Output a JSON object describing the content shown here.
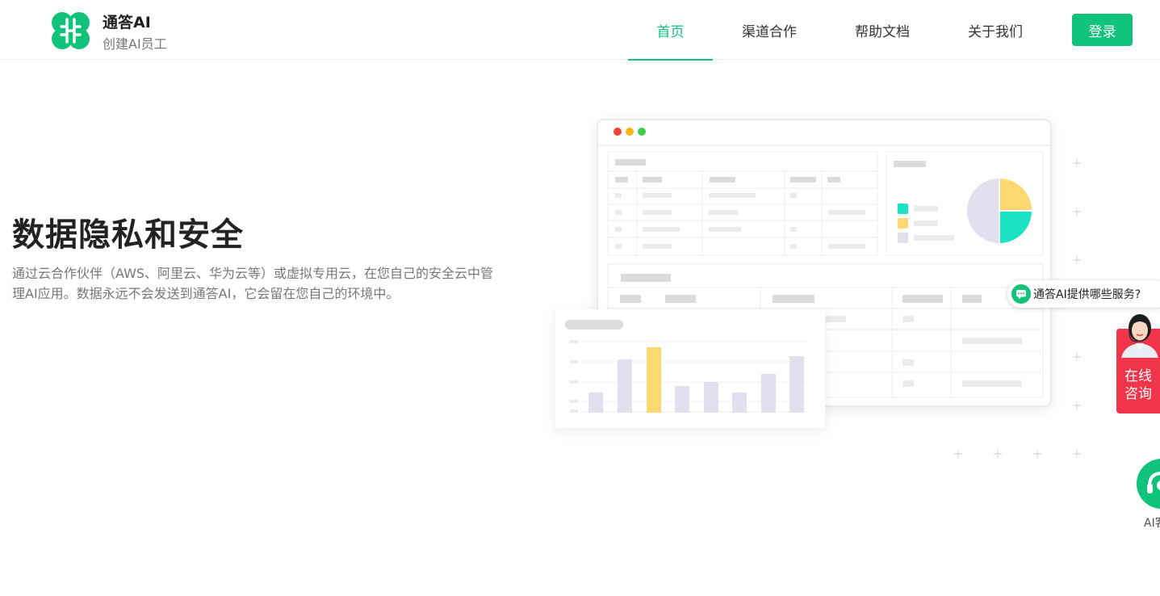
{
  "brand": {
    "title": "通答AI",
    "subtitle": "创建AI员工",
    "logo_icon": "brain-leaf-icon",
    "accent_color": "#10c27a"
  },
  "nav": {
    "items": [
      {
        "label": "首页",
        "active": true
      },
      {
        "label": "渠道合作",
        "active": false
      },
      {
        "label": "帮助文档",
        "active": false
      },
      {
        "label": "关于我们",
        "active": false
      }
    ],
    "login_label": "登录"
  },
  "hero": {
    "title": "数据隐私和安全",
    "description": "通过云合作伙伴（AWS、阿里云、华为云等）或虚拟专用云，在您自己的安全云中管理AI应用。数据永远不会发送到通答AI，它会留在您自己的环境中。"
  },
  "widgets": {
    "chat_prompt": "通答AI提供哪些服务?",
    "chat_icon": "chat-bubble-icon",
    "consult_label_1": "在线",
    "consult_label_2": "咨询",
    "consult_color": "#f0344a",
    "ai_label": "AI客",
    "ai_icon": "headset-icon"
  }
}
